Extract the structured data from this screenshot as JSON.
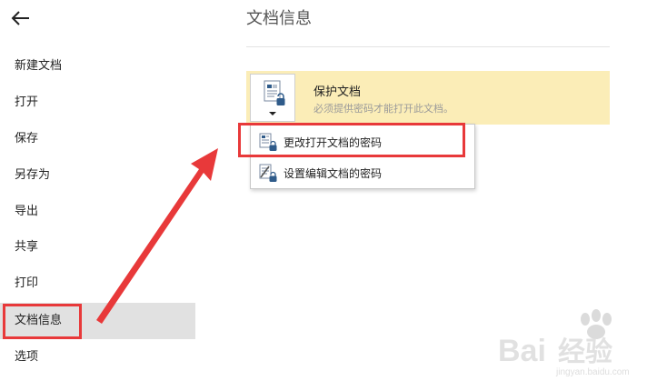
{
  "sidebar": {
    "items": [
      {
        "label": "新建文档"
      },
      {
        "label": "打开"
      },
      {
        "label": "保存"
      },
      {
        "label": "另存为"
      },
      {
        "label": "导出"
      },
      {
        "label": "共享"
      },
      {
        "label": "打印"
      },
      {
        "label": "文档信息"
      },
      {
        "label": "选项"
      }
    ],
    "active_item": "文档信息"
  },
  "main": {
    "title": "文档信息",
    "protect": {
      "title": "保护文档",
      "description": "必须提供密码才能打开此文档。",
      "icon": "document-lock-icon"
    },
    "dropdown": {
      "items": [
        {
          "label": "更改打开文档的密码",
          "icon": "document-lock-icon"
        },
        {
          "label": "设置编辑文档的密码",
          "icon": "edit-document-lock-icon"
        }
      ]
    }
  },
  "annotations": {
    "highlight_color": "#e8393a"
  },
  "watermark": {
    "logo_text": "Baidu经验",
    "url": "jingyan.baidu.com"
  },
  "colors": {
    "panel_bg": "#fbedb7",
    "active_nav_bg": "#e1e1e1",
    "doc_icon_blue": "#2f5b8a"
  }
}
